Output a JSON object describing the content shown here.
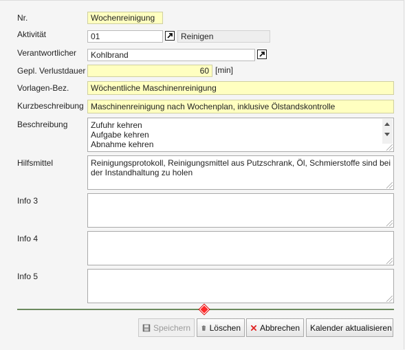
{
  "labels": {
    "nr": "Nr.",
    "aktivitaet": "Aktivität",
    "verantwortlicher": "Verantwortlicher",
    "verlustdauer": "Gepl. Verlustdauer",
    "vorlagen_bez": "Vorlagen-Bez.",
    "kurzbeschreibung": "Kurzbeschreibung",
    "beschreibung": "Beschreibung",
    "hilfsmittel": "Hilfsmittel",
    "info3": "Info 3",
    "info4": "Info 4",
    "info5": "Info 5"
  },
  "values": {
    "nr": "Wochenreinigung",
    "aktivitaet_code": "01",
    "aktivitaet_name": "Reinigen",
    "verantwortlicher": "Kohlbrand",
    "verlustdauer": "60",
    "verlustdauer_unit": "[min]",
    "vorlagen_bez": "Wöchentliche Maschinenreinigung",
    "kurzbeschreibung": "Maschinenreinigung nach Wochenplan, inklusive Ölstandskontrolle",
    "beschreibung_lines": [
      "Zufuhr kehren",
      "Aufgabe kehren",
      "Abnahme kehren"
    ],
    "hilfsmittel_lines": [
      "Reinigungsprotokoll, Reinigungsmittel aus Putzschrank, Öl, Schmierstoffe sind bei",
      "der Instandhaltung zu holen"
    ],
    "info3": "",
    "info4": "",
    "info5": ""
  },
  "buttons": {
    "speichern": "Speichern",
    "loeschen": "Löschen",
    "abbrechen": "Abbrechen",
    "kalender": "Kalender aktualisieren"
  },
  "icons": {
    "link": "arrow-link-icon",
    "save": "floppy-disk-icon",
    "delete": "trash-icon",
    "cancel": "red-x-icon"
  },
  "colors": {
    "required_field": "#ffffc0",
    "divider": "#6b8a5e",
    "marker": "#ff2a2a",
    "cancel_red": "#e02020"
  }
}
